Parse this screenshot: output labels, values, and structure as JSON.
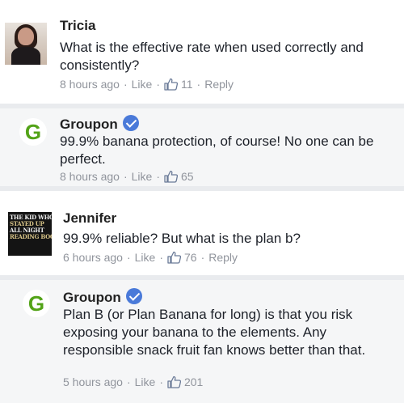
{
  "comments": [
    {
      "author": "Tricia",
      "verified": false,
      "text": "What is the effective rate when used correctly and consistently?",
      "time": "8 hours ago",
      "like_label": "Like",
      "like_count": "11",
      "reply_label": "Reply"
    },
    {
      "author": "Groupon",
      "verified": true,
      "logo_letter": "G",
      "text": "99.9% banana protection, of course! No one can be perfect.",
      "time": "8 hours ago",
      "like_label": "Like",
      "like_count": "65"
    },
    {
      "author": "Jennifer",
      "verified": false,
      "avatar_lines": [
        "THE KID WHO",
        "STAYED UP",
        "ALL NIGHT",
        "READING BOOKS"
      ],
      "text": "99.9% reliable? But what is the plan b?",
      "time": "6 hours ago",
      "like_label": "Like",
      "like_count": "76",
      "reply_label": "Reply"
    },
    {
      "author": "Groupon",
      "verified": true,
      "logo_letter": "G",
      "text": "Plan B (or Plan Banana for long) is that you risk exposing your banana to the elements. Any responsible snack fruit fan knows better than that.",
      "time": "5 hours ago",
      "like_label": "Like",
      "like_count": "201"
    }
  ],
  "colors": {
    "groupon_green": "#53a318",
    "verified_blue": "#4a7ad9",
    "reply_background": "#f5f6f7",
    "divider": "#e9ebee",
    "meta_text": "#90949c"
  }
}
